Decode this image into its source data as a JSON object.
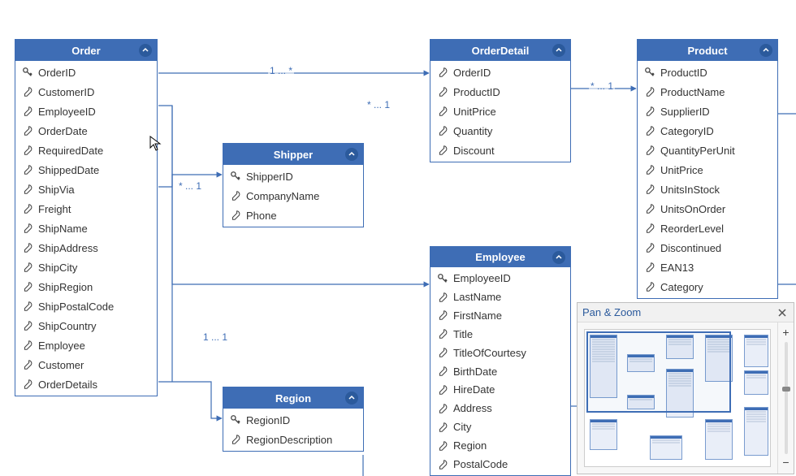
{
  "entities": {
    "order": {
      "title": "Order",
      "fields": [
        {
          "name": "OrderID",
          "key": true
        },
        {
          "name": "CustomerID",
          "key": false
        },
        {
          "name": "EmployeeID",
          "key": false
        },
        {
          "name": "OrderDate",
          "key": false
        },
        {
          "name": "RequiredDate",
          "key": false
        },
        {
          "name": "ShippedDate",
          "key": false
        },
        {
          "name": "ShipVia",
          "key": false
        },
        {
          "name": "Freight",
          "key": false
        },
        {
          "name": "ShipName",
          "key": false
        },
        {
          "name": "ShipAddress",
          "key": false
        },
        {
          "name": "ShipCity",
          "key": false
        },
        {
          "name": "ShipRegion",
          "key": false
        },
        {
          "name": "ShipPostalCode",
          "key": false
        },
        {
          "name": "ShipCountry",
          "key": false
        },
        {
          "name": "Employee",
          "key": false
        },
        {
          "name": "Customer",
          "key": false
        },
        {
          "name": "OrderDetails",
          "key": false
        }
      ]
    },
    "orderdetail": {
      "title": "OrderDetail",
      "fields": [
        {
          "name": "OrderID",
          "key": false
        },
        {
          "name": "ProductID",
          "key": false
        },
        {
          "name": "UnitPrice",
          "key": false
        },
        {
          "name": "Quantity",
          "key": false
        },
        {
          "name": "Discount",
          "key": false
        }
      ]
    },
    "product": {
      "title": "Product",
      "fields": [
        {
          "name": "ProductID",
          "key": true
        },
        {
          "name": "ProductName",
          "key": false
        },
        {
          "name": "SupplierID",
          "key": false
        },
        {
          "name": "CategoryID",
          "key": false
        },
        {
          "name": "QuantityPerUnit",
          "key": false
        },
        {
          "name": "UnitPrice",
          "key": false
        },
        {
          "name": "UnitsInStock",
          "key": false
        },
        {
          "name": "UnitsOnOrder",
          "key": false
        },
        {
          "name": "ReorderLevel",
          "key": false
        },
        {
          "name": "Discontinued",
          "key": false
        },
        {
          "name": "EAN13",
          "key": false
        },
        {
          "name": "Category",
          "key": false
        }
      ]
    },
    "shipper": {
      "title": "Shipper",
      "fields": [
        {
          "name": "ShipperID",
          "key": true
        },
        {
          "name": "CompanyName",
          "key": false
        },
        {
          "name": "Phone",
          "key": false
        }
      ]
    },
    "employee": {
      "title": "Employee",
      "fields": [
        {
          "name": "EmployeeID",
          "key": true
        },
        {
          "name": "LastName",
          "key": false
        },
        {
          "name": "FirstName",
          "key": false
        },
        {
          "name": "Title",
          "key": false
        },
        {
          "name": "TitleOfCourtesy",
          "key": false
        },
        {
          "name": "BirthDate",
          "key": false
        },
        {
          "name": "HireDate",
          "key": false
        },
        {
          "name": "Address",
          "key": false
        },
        {
          "name": "City",
          "key": false
        },
        {
          "name": "Region",
          "key": false
        },
        {
          "name": "PostalCode",
          "key": false
        }
      ]
    },
    "region": {
      "title": "Region",
      "fields": [
        {
          "name": "RegionID",
          "key": true
        },
        {
          "name": "RegionDescription",
          "key": false
        }
      ]
    }
  },
  "connectors": {
    "order_orderdetail": "1 ... *",
    "orderdetail_product": "* ... 1",
    "order_shipper": "* ... 1",
    "order_employee": "* ... 1",
    "order_region": "1 ... 1"
  },
  "panzoom": {
    "title": "Pan & Zoom"
  }
}
